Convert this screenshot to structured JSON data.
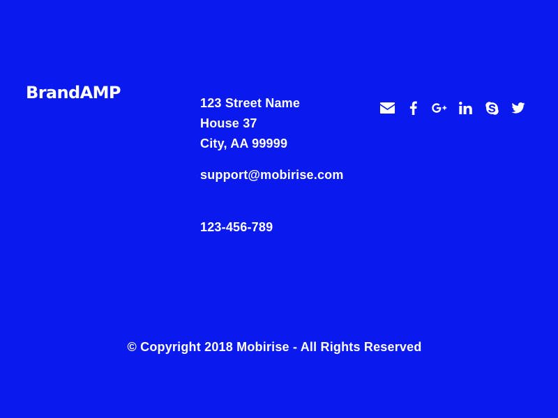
{
  "brand": {
    "name": "BrandAMP"
  },
  "address": {
    "street": "123 Street Name",
    "house": "House 37",
    "city": "City, AA 99999"
  },
  "contact": {
    "email": "support@mobirise.com",
    "phone": "123-456-789"
  },
  "social": {
    "icons": [
      "envelope-icon",
      "facebook-icon",
      "google-plus-icon",
      "linkedin-icon",
      "skype-icon",
      "twitter-icon"
    ]
  },
  "footer": {
    "copyright": "© Copyright 2018 Mobirise - All Rights Reserved"
  },
  "colors": {
    "background": "#0a19ee",
    "text": "#ffffff"
  }
}
